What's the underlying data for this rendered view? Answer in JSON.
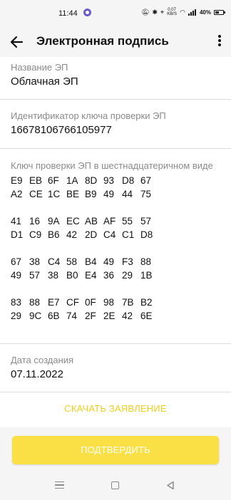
{
  "status_bar": {
    "time": "11:44",
    "speed_value": "0.07",
    "speed_unit": "KB/S",
    "battery": "40%"
  },
  "app_bar": {
    "title": "Электронная подпись",
    "back_icon": "arrow-left-icon",
    "menu_icon": "more-vertical-icon"
  },
  "fields": {
    "name": {
      "label": "Название ЭП",
      "value": "Облачная ЭП"
    },
    "key_id": {
      "label": "Идентификатор ключа проверки ЭП",
      "value": "16678106766105977"
    },
    "public_key": {
      "label": "Ключ проверки ЭП в шестнадцатеричном виде",
      "groups": [
        [
          [
            "E9",
            "EB",
            "6F",
            "1A",
            "8D",
            "93",
            "D8",
            "67"
          ],
          [
            "A2",
            "CE",
            "1C",
            "BE",
            "B9",
            "49",
            "44",
            "75"
          ]
        ],
        [
          [
            "41",
            "16",
            "9A",
            "EC",
            "AB",
            "AF",
            "55",
            "57"
          ],
          [
            "D1",
            "C9",
            "B6",
            "42",
            "2D",
            "C4",
            "C1",
            "D8"
          ]
        ],
        [
          [
            "67",
            "38",
            "C4",
            "58",
            "B4",
            "49",
            "F3",
            "88"
          ],
          [
            "49",
            "57",
            "38",
            "B0",
            "E4",
            "36",
            "29",
            "1B"
          ]
        ],
        [
          [
            "83",
            "88",
            "E7",
            "CF",
            "0F",
            "98",
            "7B",
            "B2"
          ],
          [
            "29",
            "9C",
            "6B",
            "74",
            "2F",
            "2E",
            "42",
            "6E"
          ]
        ]
      ]
    },
    "created": {
      "label": "Дата создания",
      "value": "07.11.2022"
    }
  },
  "actions": {
    "download_label": "СКАЧАТЬ ЗАЯВЛЕНИЕ",
    "confirm_label": "ПОДТВЕРДИТЬ"
  },
  "colors": {
    "accent": "#fbe045",
    "link": "#f2cc1b",
    "label": "#8a8a8a"
  }
}
